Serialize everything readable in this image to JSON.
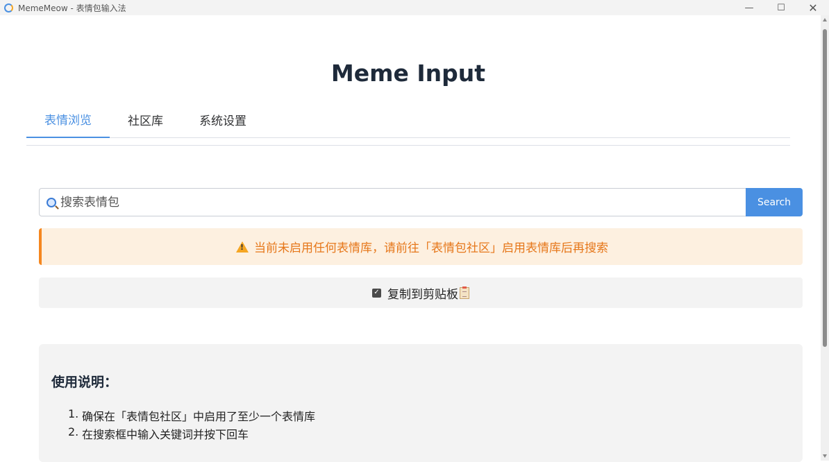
{
  "window": {
    "title": "MemeMeow - 表情包输入法",
    "minimize": "—",
    "maximize": "☐",
    "close": "✕"
  },
  "app": {
    "title": "Meme Input"
  },
  "tabs": [
    {
      "label": "表情浏览",
      "active": true
    },
    {
      "label": "社区库",
      "active": false
    },
    {
      "label": "系统设置",
      "active": false
    }
  ],
  "search": {
    "placeholder": "搜索表情包",
    "value": "",
    "button_label": "Search"
  },
  "warning": {
    "text": "当前未启用任何表情库，请前往「表情包社区」启用表情库后再搜索"
  },
  "clipboard": {
    "label": "复制到剪贴板",
    "checked": true
  },
  "help": {
    "title": "使用说明：",
    "items": [
      {
        "num": "1.",
        "text": "确保在「表情包社区」中启用了至少一个表情库"
      },
      {
        "num": "2.",
        "text": "在搜索框中输入关键词并按下回车"
      }
    ]
  },
  "colors": {
    "accent": "#4a90e2",
    "warning_text": "#e6771a",
    "warning_bg": "#fdf0e0",
    "warning_border": "#f5871f"
  }
}
